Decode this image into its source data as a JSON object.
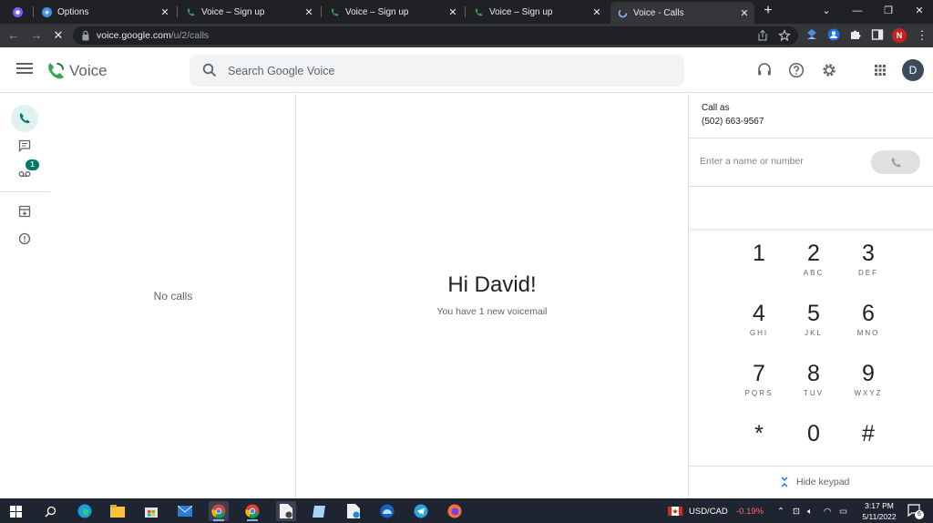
{
  "browser": {
    "tabs": [
      {
        "title": "",
        "icon": "extension-icon"
      },
      {
        "title": "Options",
        "icon": "options-icon"
      },
      {
        "title": "Voice – Sign up",
        "icon": "google-voice-icon"
      },
      {
        "title": "Voice – Sign up",
        "icon": "google-voice-icon"
      },
      {
        "title": "Voice – Sign up",
        "icon": "google-voice-icon"
      },
      {
        "title": "Voice - Calls",
        "icon": "loading-icon",
        "active": true
      }
    ],
    "url_host": "voice.google.com",
    "url_path": "/u/2/calls",
    "profile_initial": "N"
  },
  "app": {
    "name": "Voice",
    "search_placeholder": "Search Google Voice",
    "avatar_initial": "D"
  },
  "nav": {
    "voicemail_badge": "1"
  },
  "calls": {
    "empty_text": "No calls"
  },
  "main": {
    "greeting": "Hi David!",
    "subtitle": "You have 1 new voicemail"
  },
  "dialer": {
    "call_as_label": "Call as",
    "call_as_number": "(502) 663-9567",
    "input_placeholder": "Enter a name or number",
    "keys": [
      {
        "digit": "1",
        "letters": ""
      },
      {
        "digit": "2",
        "letters": "ABC"
      },
      {
        "digit": "3",
        "letters": "DEF"
      },
      {
        "digit": "4",
        "letters": "GHI"
      },
      {
        "digit": "5",
        "letters": "JKL"
      },
      {
        "digit": "6",
        "letters": "MNO"
      },
      {
        "digit": "7",
        "letters": "PQRS"
      },
      {
        "digit": "8",
        "letters": "TUV"
      },
      {
        "digit": "9",
        "letters": "WXYZ"
      },
      {
        "digit": "*",
        "letters": ""
      },
      {
        "digit": "0",
        "letters": ""
      },
      {
        "digit": "#",
        "letters": ""
      }
    ],
    "hide_keypad_label": "Hide keypad"
  },
  "taskbar": {
    "currency_label": "USD/CAD",
    "currency_change": "-0.19%",
    "time": "3:17 PM",
    "date": "5/11/2022",
    "notification_count": "6",
    "colors": {
      "accent": "#00796b",
      "currency_change": "#ff6b6b"
    }
  }
}
